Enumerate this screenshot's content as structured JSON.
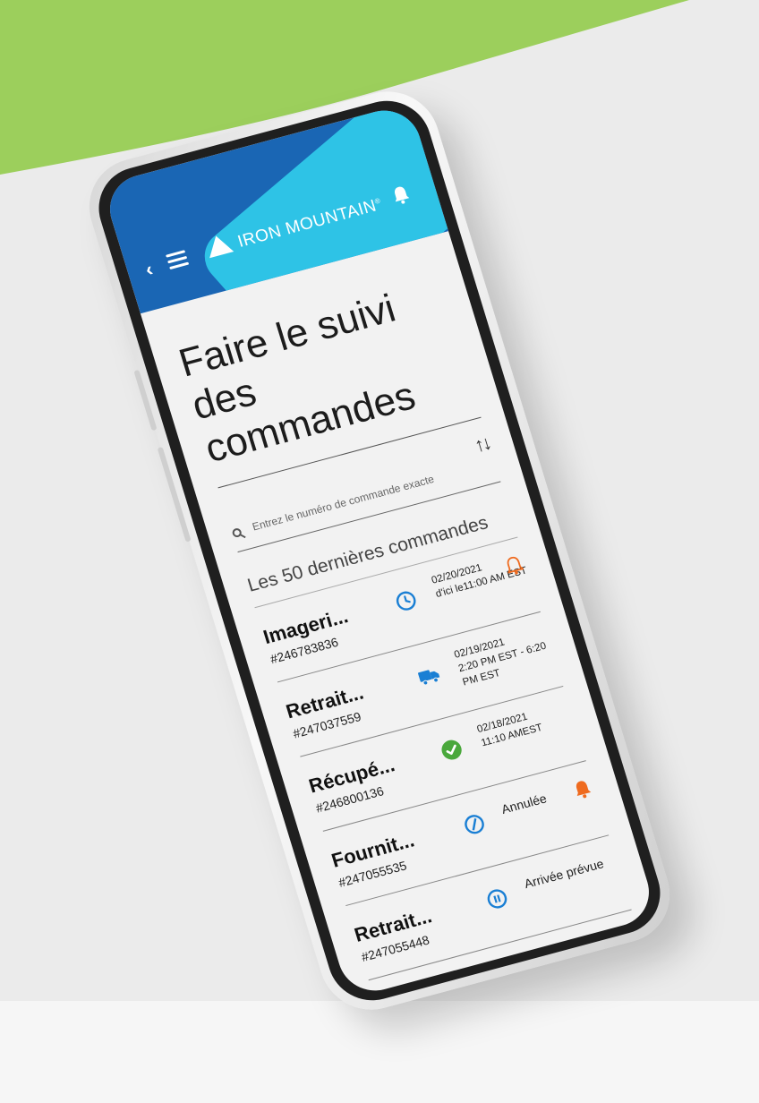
{
  "colors": {
    "green_shape": "#9ccf5c",
    "header_blue": "#1a66b4",
    "header_cyan": "#2ec3e6",
    "accent_blue": "#1a7fd4",
    "success_green": "#4aa83c",
    "alert_orange": "#ef6b1f"
  },
  "header": {
    "brand": "IRON MOUNTAIN",
    "brand_mark": "®",
    "back_icon": "chevron-left-icon",
    "menu_icon": "hamburger-menu-icon",
    "notifications_icon": "bell-icon"
  },
  "page": {
    "title": "Faire le suivi des commandes"
  },
  "search": {
    "placeholder": "Entrez le numéro de commande exacte",
    "value": ""
  },
  "sort": {
    "icon": "sort-arrows-icon",
    "label": "↑↓"
  },
  "orders_section": {
    "label": "Les 50 dernières commandes"
  },
  "orders": [
    {
      "name": "Imageri...",
      "number": "#246783836",
      "status_icon": "clock-icon",
      "status_line1": "02/20/2021",
      "status_line2": "d'ici le11:00 AM EST",
      "alert": "bell-outline-icon"
    },
    {
      "name": "Retrait...",
      "number": "#247037559",
      "status_icon": "truck-icon",
      "status_line1": "02/19/2021",
      "status_line2": "2:20 PM EST - 6:20 PM EST",
      "alert": ""
    },
    {
      "name": "Récupé...",
      "number": "#246800136",
      "status_icon": "check-circle-icon",
      "status_line1": "02/18/2021",
      "status_line2": "11:10 AMEST",
      "alert": ""
    },
    {
      "name": "Fournit...",
      "number": "#247055535",
      "status_icon": "cancelled-circle-icon",
      "status_line1": "Annulée",
      "status_line2": "",
      "alert": "bell-filled-icon"
    },
    {
      "name": "Retrait...",
      "number": "#247055448",
      "status_icon": "pause-circle-icon",
      "status_line1": "Arrivée prévue",
      "status_line2": "",
      "alert": ""
    }
  ]
}
